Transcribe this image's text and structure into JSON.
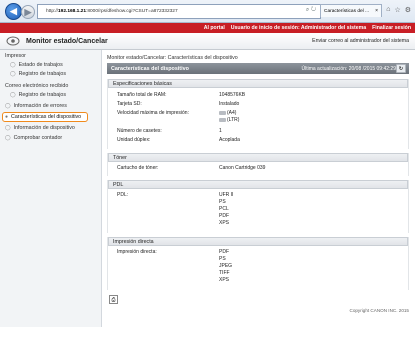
{
  "browser": {
    "url_prefix": "http://",
    "url_host": "192.168.1.21",
    "url_path": ":8000/rps/dfeshow.cgi?CSUT=a872332327",
    "tab_label": "Características del ...",
    "back_icon": "back-arrow-icon",
    "forward_icon": "forward-arrow-icon"
  },
  "top_bar": {
    "portal": "Al portal",
    "user_info": "Usuario de inicio de sesión: Administrador del sistema",
    "logout": "Finalizar sesión"
  },
  "header": {
    "title": "Monitor estado/Cancelar",
    "send_mail": "Enviar correo al administrador del sistema"
  },
  "sidebar": {
    "items": [
      {
        "label": "Impresor",
        "level": 0
      },
      {
        "label": "Estado de trabajos",
        "level": 1
      },
      {
        "label": "Registro de trabajos",
        "level": 1
      },
      {
        "label": "Correo electrónico recibido",
        "level": 0
      },
      {
        "label": "Registro de trabajos",
        "level": 1
      },
      {
        "label": "Información de errores",
        "level": 0
      },
      {
        "label": "Características del dispositivo",
        "level": 0,
        "selected": true
      },
      {
        "label": "Información de dispositivo",
        "level": 0
      },
      {
        "label": "Comprobar contador",
        "level": 0
      }
    ]
  },
  "main": {
    "breadcrumb": "Monitor estado/Cancelar: Características del dispositivo",
    "page_title": "Características del dispositivo",
    "last_update": "Última actualización: 20/08 /2015 09:42:29",
    "sections": {
      "basic": {
        "title": "Especificaciones básicas",
        "rows": [
          {
            "label": "Tamaño total de RAM:",
            "value": "1048576KB"
          },
          {
            "label": "Tarjeta SD:",
            "value": "Instalado"
          },
          {
            "label": "Velocidad máxima de impresión:",
            "value_lines": [
              "(A4)",
              "(LTR)"
            ]
          },
          {
            "label": "Número de casetes:",
            "value": "1"
          },
          {
            "label": "Unidad dúplex:",
            "value": "Acoplada"
          }
        ]
      },
      "toner": {
        "title": "Tóner",
        "rows": [
          {
            "label": "Cartucho de tóner:",
            "value": "Canon Cartridge 039"
          }
        ]
      },
      "pdl": {
        "title": "PDL",
        "label": "PDL:",
        "values": [
          "UFR II",
          "PS",
          "PCL",
          "PDF",
          "XPS"
        ]
      },
      "direct": {
        "title": "Impresión directa",
        "label": "Impresión directa:",
        "values": [
          "PDF",
          "PS",
          "JPEG",
          "TIFF",
          "XPS"
        ]
      }
    },
    "copyright": "Copyright CANON INC. 2015"
  }
}
